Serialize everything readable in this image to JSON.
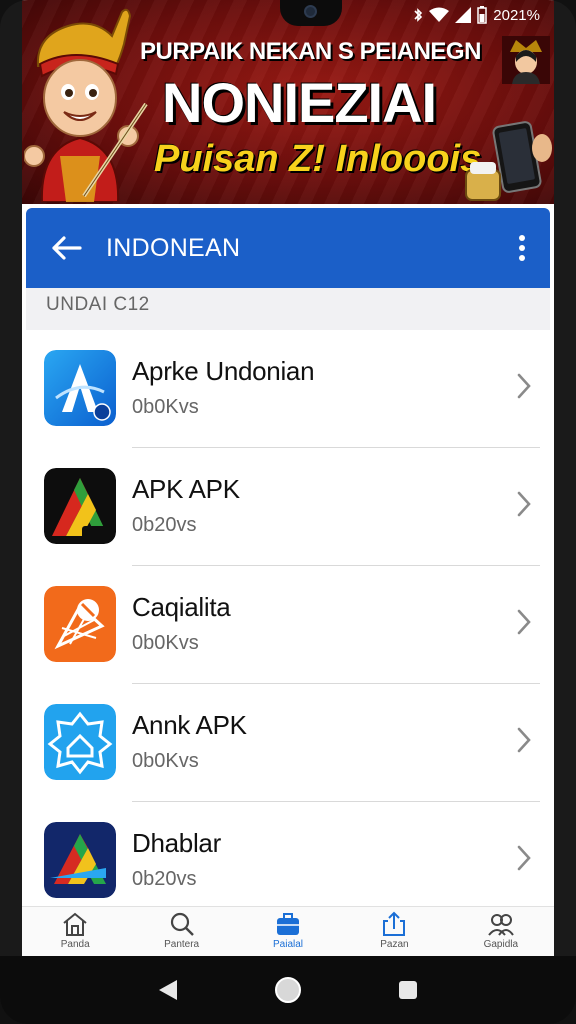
{
  "status_bar": {
    "time": "2021%"
  },
  "banner": {
    "line1": "PURPAIK NEKAN S PEIANEGN",
    "line2": "NONIEZIAI",
    "line3": "Puisan Z! Inlooois"
  },
  "app_bar": {
    "title": "INDONEAN"
  },
  "section": {
    "label": "UNDAI C12"
  },
  "apps": [
    {
      "name": "Aprke Undonian",
      "size": "0b0Kvs",
      "icon": "blue-a-icon"
    },
    {
      "name": "APK APK",
      "size": "0b20vs",
      "icon": "tricolor-a-icon"
    },
    {
      "name": "Caqialita",
      "size": "0b0Kvs",
      "icon": "orange-shield-icon"
    },
    {
      "name": "Annk APK",
      "size": "0b0Kvs",
      "icon": "blue-home-badge-icon"
    },
    {
      "name": "Dhablar",
      "size": "0b20vs",
      "icon": "navy-a-icon"
    }
  ],
  "bottom_nav": [
    {
      "label": "Panda",
      "icon": "home-icon",
      "active": false
    },
    {
      "label": "Pantera",
      "icon": "search-icon",
      "active": false
    },
    {
      "label": "Paialal",
      "icon": "briefcase-icon",
      "active": true
    },
    {
      "label": "Pazan",
      "icon": "share-icon",
      "active": false
    },
    {
      "label": "Gapidla",
      "icon": "people-icon",
      "active": false
    }
  ],
  "colors": {
    "app_bar": "#1b5fc8",
    "banner": "#7a1210",
    "accent_yellow": "#f7d21c",
    "active_nav": "#1b6fd6"
  }
}
